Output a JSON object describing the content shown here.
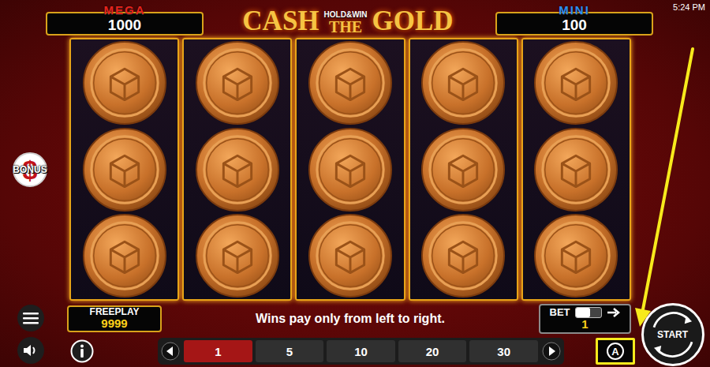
{
  "clock": "5:24 PM",
  "title": {
    "main": "CASH",
    "badge": "HOLD&WIN",
    "middle": "THE",
    "end": "GOLD"
  },
  "jackpots": [
    {
      "label": "MEGA",
      "value": "1000",
      "color": "#e8231c"
    },
    {
      "label": "MINI",
      "value": "100",
      "color": "#2f8ff0"
    }
  ],
  "bonus": {
    "icon": "$",
    "label": "BONUS"
  },
  "reels": [
    [
      {
        "kind": "coin"
      },
      {
        "kind": "coin"
      },
      {
        "kind": "coin"
      }
    ],
    [
      {
        "kind": "coin"
      },
      {
        "kind": "coin"
      },
      {
        "kind": "coin"
      }
    ],
    [
      {
        "kind": "coin"
      },
      {
        "kind": "coin"
      },
      {
        "kind": "coin"
      }
    ],
    [
      {
        "kind": "coin"
      },
      {
        "kind": "coin"
      },
      {
        "kind": "coin"
      }
    ],
    [
      {
        "kind": "coin"
      },
      {
        "kind": "coin"
      },
      {
        "kind": "coin"
      }
    ]
  ],
  "freeplay": {
    "label": "FREEPLAY",
    "value": "9999"
  },
  "message": "Wins pay only from left to right.",
  "bet": {
    "label": "BET",
    "value": "1",
    "toggle_on": false
  },
  "bet_options": [
    {
      "label": "1",
      "selected": true
    },
    {
      "label": "5",
      "selected": false
    },
    {
      "label": "10",
      "selected": false
    },
    {
      "label": "20",
      "selected": false
    },
    {
      "label": "30",
      "selected": false
    }
  ],
  "autoplay": {
    "label": "A",
    "highlighted": true
  },
  "start": {
    "label": "START"
  },
  "annotation": {
    "arrow": true
  }
}
